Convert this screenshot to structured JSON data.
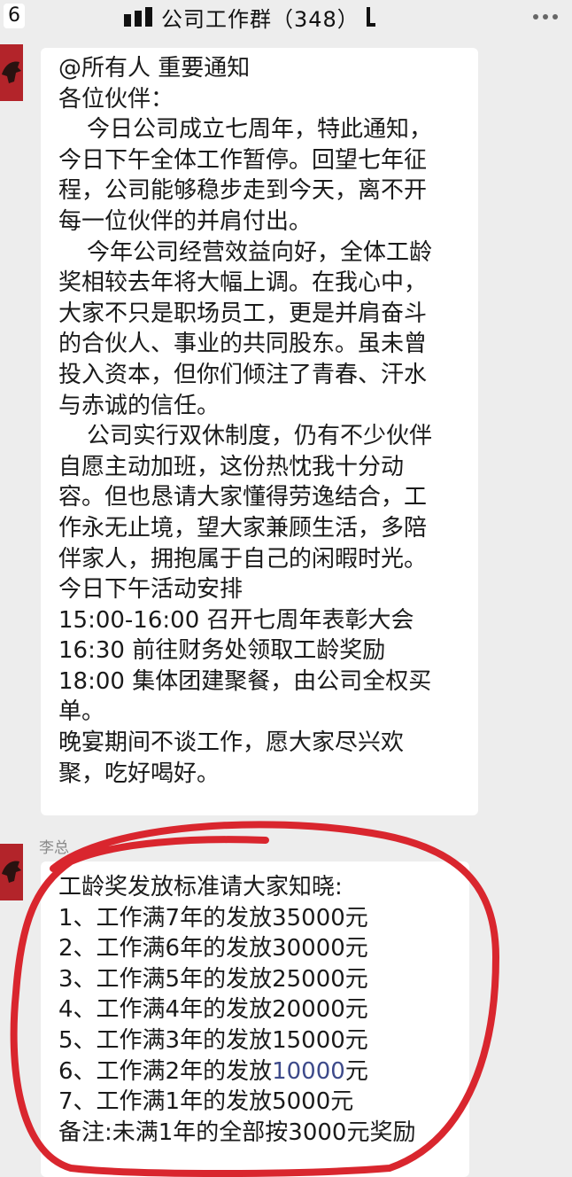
{
  "header": {
    "back_count": "6",
    "title": "公司工作群（348）"
  },
  "message1": {
    "lines": [
      "@所有人 重要通知",
      "各位伙伴：",
      "今日公司成立七周年，特此通知，",
      "今日下午全体工作暂停。回望七年征",
      "程，公司能够稳步走到今天，离不开",
      "每一位伙伴的并肩付出。",
      "今年公司经营效益向好，全体工龄",
      "奖相较去年将大幅上调。在我心中，",
      "大家不只是职场员工，更是并肩奋斗",
      "的合伙人、事业的共同股东。虽未曾",
      "投入资本，但你们倾注了青春、汗水",
      "与赤诚的信任。",
      "公司实行双休制度，仍有不少伙伴",
      "自愿主动加班，这份热忱我十分动",
      "容。但也恳请大家懂得劳逸结合，工",
      "作永无止境，望大家兼顾生活，多陪",
      "伴家人，拥抱属于自己的闲暇时光。",
      "今日下午活动安排",
      "15:00-16:00 召开七周年表彰大会",
      "16:30 前往财务处领取工龄奖励",
      "18:00 集体团建聚餐，由公司全权买",
      "单。",
      "晚宴期间不谈工作，愿大家尽兴欢",
      "聚，吃好喝好。"
    ]
  },
  "message2": {
    "sender": "李总",
    "lines": [
      "工龄奖发放标准请大家知晓:",
      "1、工作满7年的发放35000元",
      "2、工作满6年的发放30000元",
      "3、工作满5年的发放25000元",
      "4、工作满4年的发放20000元",
      "5、工作满3年的发放15000元",
      "6、工作满2年的发放",
      "10000",
      "元",
      "7、工作满1年的发放5000元",
      "备注:未满1年的全部按3000元奖励"
    ]
  },
  "colors": {
    "background": "#ededed",
    "bubble": "#ffffff",
    "highlight": "#d9262e",
    "avatar": "#b5262a"
  },
  "icons": {
    "more": "more-dots-icon",
    "signal": "signal-bars-icon"
  }
}
